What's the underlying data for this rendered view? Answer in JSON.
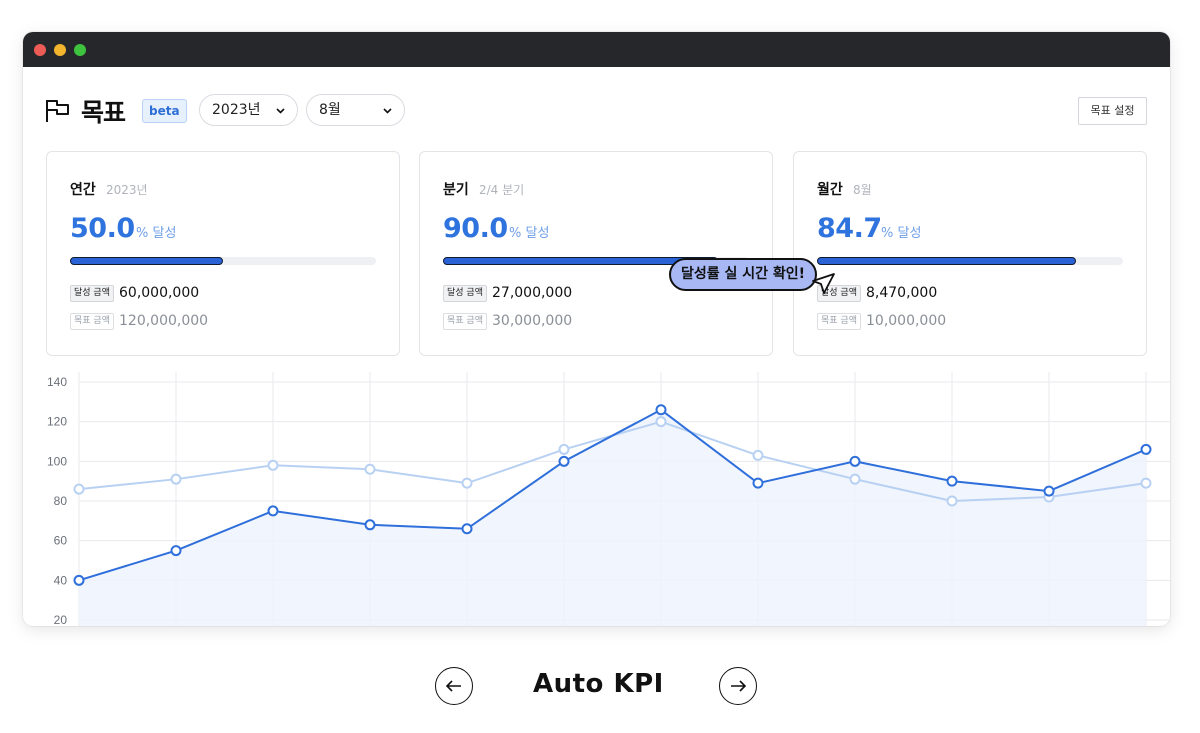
{
  "window": {
    "controls": [
      "close",
      "minimize",
      "maximize"
    ]
  },
  "header": {
    "title": "목표",
    "badge": "beta",
    "year_select": "2023년",
    "month_select": "8월",
    "goal_button": "목표 설정",
    "icons": {
      "title": "flag-icon",
      "select": "chevron-down-icon"
    }
  },
  "cards": [
    {
      "title": "연간",
      "sub": "2023년",
      "value": "50.0",
      "unit": "% 달성",
      "progress": 0.5,
      "ach_label": "달성 금액",
      "ach_value": "60,000,000",
      "goal_label": "목표 금액",
      "goal_value": "120,000,000"
    },
    {
      "title": "분기",
      "sub": "2/4 분기",
      "value": "90.0",
      "unit": "% 달성",
      "progress": 0.9,
      "ach_label": "달성 금액",
      "ach_value": "27,000,000",
      "goal_label": "목표 금액",
      "goal_value": "30,000,000"
    },
    {
      "title": "월간",
      "sub": "8월",
      "value": "84.7",
      "unit": "% 달성",
      "progress": 0.847,
      "ach_label": "달성 금액",
      "ach_value": "8,470,000",
      "goal_label": "목표 금액",
      "goal_value": "10,000,000"
    }
  ],
  "tooltip": {
    "text": "달성률 실 시간 확인!",
    "icon": "cursor-arrow-icon"
  },
  "chart_data": {
    "type": "line",
    "ylim": [
      20,
      140
    ],
    "yticks": [
      20,
      40,
      60,
      80,
      100,
      120,
      140
    ],
    "grid": true,
    "x": [
      1,
      2,
      3,
      4,
      5,
      6,
      7,
      8,
      9,
      10,
      11,
      12
    ],
    "series": [
      {
        "values": [
          40,
          55,
          75,
          68,
          66,
          100,
          126,
          89,
          100,
          90,
          85,
          106
        ],
        "color": "#2f6fdb",
        "fill": true
      },
      {
        "values": [
          86,
          91,
          98,
          96,
          89,
          106,
          120,
          103,
          91,
          80,
          82,
          89
        ],
        "color": "#b8d1f3",
        "fill": false
      }
    ]
  },
  "bottom_nav": {
    "title": "Auto KPI",
    "prev_icon": "arrow-left-icon",
    "next_icon": "arrow-right-icon"
  }
}
